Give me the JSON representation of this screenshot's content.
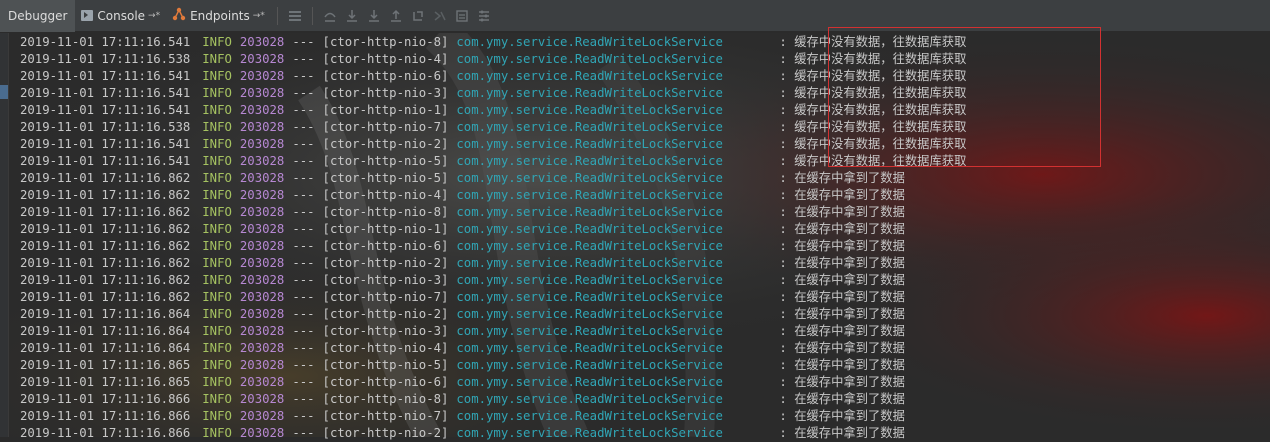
{
  "toolbar": {
    "tabs": [
      {
        "label": "Debugger"
      },
      {
        "label": "Console",
        "pin": "→*"
      },
      {
        "label": "Endpoints",
        "pin": "→*"
      }
    ],
    "icons": [
      "list-icon",
      "step-over-icon",
      "step-into-icon",
      "force-step-into-icon",
      "step-out-icon",
      "drop-frame-icon",
      "run-to-cursor-icon",
      "evaluate-icon",
      "settings-list-icon"
    ]
  },
  "log": {
    "colors": {
      "level": "#a5c261",
      "pid": "#b788d3",
      "class": "#30a5b5",
      "text": "#c8c8c8",
      "highlight": "#d23131"
    },
    "lines": [
      {
        "time": "2019-11-01 17:11:16.541",
        "level": "INFO",
        "pid": "203028",
        "dash": "---",
        "thread": "[ctor-http-nio-8]",
        "cls": "com.ymy.service.ReadWriteLockService",
        "msg": ": 缓存中没有数据，往数据库获取"
      },
      {
        "time": "2019-11-01 17:11:16.538",
        "level": "INFO",
        "pid": "203028",
        "dash": "---",
        "thread": "[ctor-http-nio-4]",
        "cls": "com.ymy.service.ReadWriteLockService",
        "msg": ": 缓存中没有数据，往数据库获取"
      },
      {
        "time": "2019-11-01 17:11:16.541",
        "level": "INFO",
        "pid": "203028",
        "dash": "---",
        "thread": "[ctor-http-nio-6]",
        "cls": "com.ymy.service.ReadWriteLockService",
        "msg": ": 缓存中没有数据，往数据库获取"
      },
      {
        "time": "2019-11-01 17:11:16.541",
        "level": "INFO",
        "pid": "203028",
        "dash": "---",
        "thread": "[ctor-http-nio-3]",
        "cls": "com.ymy.service.ReadWriteLockService",
        "msg": ": 缓存中没有数据，往数据库获取"
      },
      {
        "time": "2019-11-01 17:11:16.541",
        "level": "INFO",
        "pid": "203028",
        "dash": "---",
        "thread": "[ctor-http-nio-1]",
        "cls": "com.ymy.service.ReadWriteLockService",
        "msg": ": 缓存中没有数据，往数据库获取"
      },
      {
        "time": "2019-11-01 17:11:16.538",
        "level": "INFO",
        "pid": "203028",
        "dash": "---",
        "thread": "[ctor-http-nio-7]",
        "cls": "com.ymy.service.ReadWriteLockService",
        "msg": ": 缓存中没有数据，往数据库获取"
      },
      {
        "time": "2019-11-01 17:11:16.541",
        "level": "INFO",
        "pid": "203028",
        "dash": "---",
        "thread": "[ctor-http-nio-2]",
        "cls": "com.ymy.service.ReadWriteLockService",
        "msg": ": 缓存中没有数据，往数据库获取"
      },
      {
        "time": "2019-11-01 17:11:16.541",
        "level": "INFO",
        "pid": "203028",
        "dash": "---",
        "thread": "[ctor-http-nio-5]",
        "cls": "com.ymy.service.ReadWriteLockService",
        "msg": ": 缓存中没有数据，往数据库获取"
      },
      {
        "time": "2019-11-01 17:11:16.862",
        "level": "INFO",
        "pid": "203028",
        "dash": "---",
        "thread": "[ctor-http-nio-5]",
        "cls": "com.ymy.service.ReadWriteLockService",
        "msg": ": 在缓存中拿到了数据"
      },
      {
        "time": "2019-11-01 17:11:16.862",
        "level": "INFO",
        "pid": "203028",
        "dash": "---",
        "thread": "[ctor-http-nio-4]",
        "cls": "com.ymy.service.ReadWriteLockService",
        "msg": ": 在缓存中拿到了数据"
      },
      {
        "time": "2019-11-01 17:11:16.862",
        "level": "INFO",
        "pid": "203028",
        "dash": "---",
        "thread": "[ctor-http-nio-8]",
        "cls": "com.ymy.service.ReadWriteLockService",
        "msg": ": 在缓存中拿到了数据"
      },
      {
        "time": "2019-11-01 17:11:16.862",
        "level": "INFO",
        "pid": "203028",
        "dash": "---",
        "thread": "[ctor-http-nio-1]",
        "cls": "com.ymy.service.ReadWriteLockService",
        "msg": ": 在缓存中拿到了数据"
      },
      {
        "time": "2019-11-01 17:11:16.862",
        "level": "INFO",
        "pid": "203028",
        "dash": "---",
        "thread": "[ctor-http-nio-6]",
        "cls": "com.ymy.service.ReadWriteLockService",
        "msg": ": 在缓存中拿到了数据"
      },
      {
        "time": "2019-11-01 17:11:16.862",
        "level": "INFO",
        "pid": "203028",
        "dash": "---",
        "thread": "[ctor-http-nio-2]",
        "cls": "com.ymy.service.ReadWriteLockService",
        "msg": ": 在缓存中拿到了数据"
      },
      {
        "time": "2019-11-01 17:11:16.862",
        "level": "INFO",
        "pid": "203028",
        "dash": "---",
        "thread": "[ctor-http-nio-3]",
        "cls": "com.ymy.service.ReadWriteLockService",
        "msg": ": 在缓存中拿到了数据"
      },
      {
        "time": "2019-11-01 17:11:16.862",
        "level": "INFO",
        "pid": "203028",
        "dash": "---",
        "thread": "[ctor-http-nio-7]",
        "cls": "com.ymy.service.ReadWriteLockService",
        "msg": ": 在缓存中拿到了数据"
      },
      {
        "time": "2019-11-01 17:11:16.864",
        "level": "INFO",
        "pid": "203028",
        "dash": "---",
        "thread": "[ctor-http-nio-2]",
        "cls": "com.ymy.service.ReadWriteLockService",
        "msg": ": 在缓存中拿到了数据"
      },
      {
        "time": "2019-11-01 17:11:16.864",
        "level": "INFO",
        "pid": "203028",
        "dash": "---",
        "thread": "[ctor-http-nio-3]",
        "cls": "com.ymy.service.ReadWriteLockService",
        "msg": ": 在缓存中拿到了数据"
      },
      {
        "time": "2019-11-01 17:11:16.864",
        "level": "INFO",
        "pid": "203028",
        "dash": "---",
        "thread": "[ctor-http-nio-4]",
        "cls": "com.ymy.service.ReadWriteLockService",
        "msg": ": 在缓存中拿到了数据"
      },
      {
        "time": "2019-11-01 17:11:16.865",
        "level": "INFO",
        "pid": "203028",
        "dash": "---",
        "thread": "[ctor-http-nio-5]",
        "cls": "com.ymy.service.ReadWriteLockService",
        "msg": ": 在缓存中拿到了数据"
      },
      {
        "time": "2019-11-01 17:11:16.865",
        "level": "INFO",
        "pid": "203028",
        "dash": "---",
        "thread": "[ctor-http-nio-6]",
        "cls": "com.ymy.service.ReadWriteLockService",
        "msg": ": 在缓存中拿到了数据"
      },
      {
        "time": "2019-11-01 17:11:16.866",
        "level": "INFO",
        "pid": "203028",
        "dash": "---",
        "thread": "[ctor-http-nio-8]",
        "cls": "com.ymy.service.ReadWriteLockService",
        "msg": ": 在缓存中拿到了数据"
      },
      {
        "time": "2019-11-01 17:11:16.866",
        "level": "INFO",
        "pid": "203028",
        "dash": "---",
        "thread": "[ctor-http-nio-7]",
        "cls": "com.ymy.service.ReadWriteLockService",
        "msg": ": 在缓存中拿到了数据"
      },
      {
        "time": "2019-11-01 17:11:16.866",
        "level": "INFO",
        "pid": "203028",
        "dash": "---",
        "thread": "[ctor-http-nio-2]",
        "cls": "com.ymy.service.ReadWriteLockService",
        "msg": ": 在缓存中拿到了数据"
      }
    ]
  }
}
